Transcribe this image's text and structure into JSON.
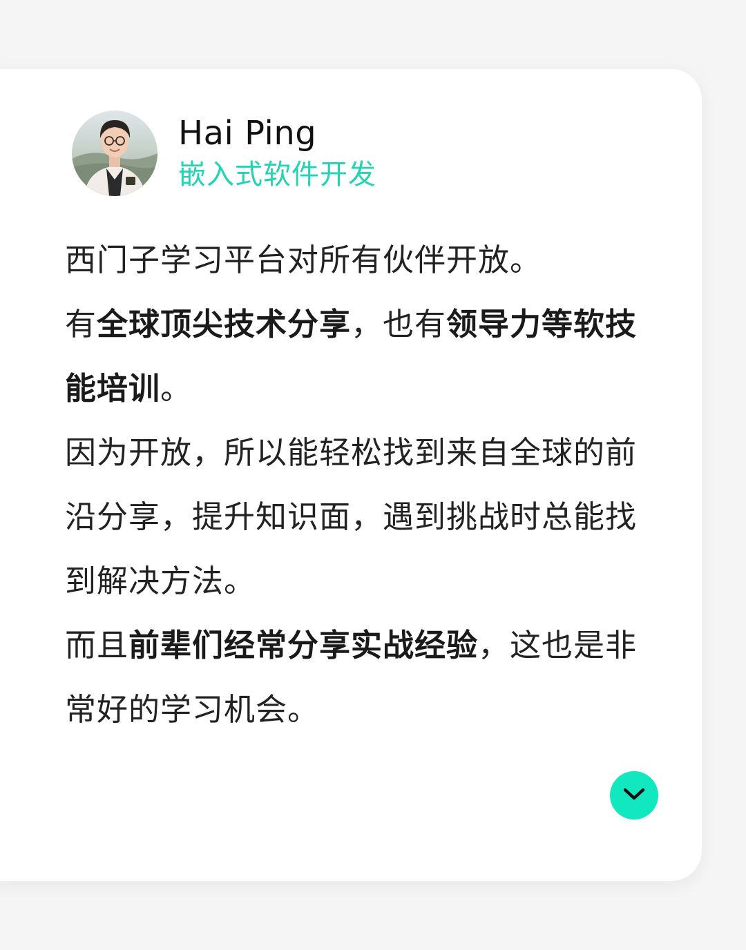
{
  "profile": {
    "name": "Hai Ping",
    "role": "嵌入式软件开发"
  },
  "body": {
    "p1": {
      "s1": "西门子学习平台对所有伙伴开放。",
      "s2": "有",
      "b1": "全球顶尖技术分享",
      "s3": "，也有",
      "b2": "领导力等软技能培训",
      "s4": "。"
    },
    "p2": {
      "s1": "因为开放，所以能轻松找到来自全球的前沿分享，提升知识面，遇到挑战时总能找到解决方法。"
    },
    "p3": {
      "s1": "而且",
      "b1": "前辈们经常分享实战经验",
      "s2": "，这也是非常好的学习机会。"
    }
  },
  "expand_button": {
    "icon": "chevron-down-icon"
  },
  "colors": {
    "accent": "#12e8c0",
    "role_text": "#22d3b4",
    "background": "#f5f5f5",
    "card": "#ffffff"
  }
}
